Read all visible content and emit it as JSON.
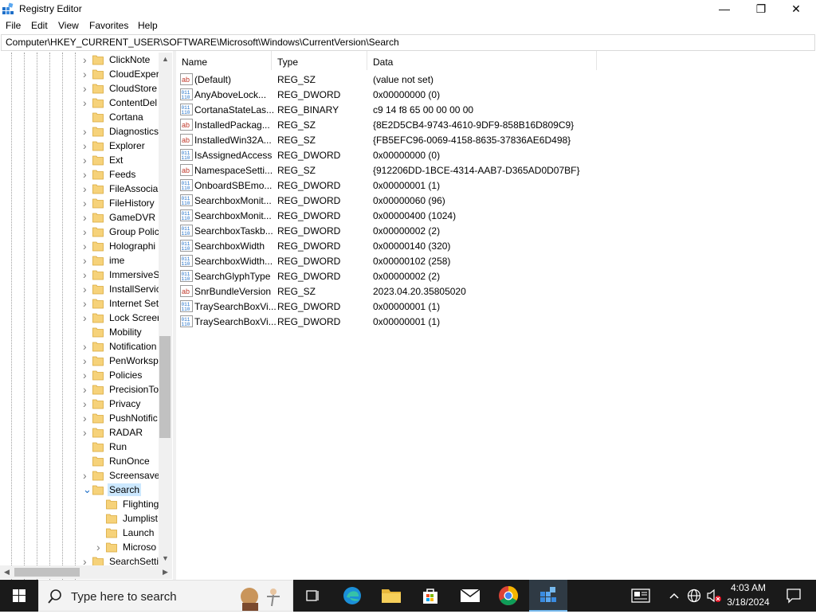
{
  "window": {
    "title": "Registry Editor",
    "minimize_glyph": "—",
    "maximize_glyph": "❐",
    "close_glyph": "✕"
  },
  "menu": [
    "File",
    "Edit",
    "View",
    "Favorites",
    "Help"
  ],
  "address": "Computer\\HKEY_CURRENT_USER\\SOFTWARE\\Microsoft\\Windows\\CurrentVersion\\Search",
  "tree": {
    "items": [
      {
        "label": "ClickNote",
        "expander": "collapsed"
      },
      {
        "label": "CloudExper",
        "expander": "collapsed"
      },
      {
        "label": "CloudStore",
        "expander": "collapsed"
      },
      {
        "label": "ContentDel",
        "expander": "collapsed"
      },
      {
        "label": "Cortana",
        "expander": "none"
      },
      {
        "label": "Diagnostics",
        "expander": "collapsed"
      },
      {
        "label": "Explorer",
        "expander": "collapsed"
      },
      {
        "label": "Ext",
        "expander": "collapsed"
      },
      {
        "label": "Feeds",
        "expander": "collapsed"
      },
      {
        "label": "FileAssocia",
        "expander": "collapsed"
      },
      {
        "label": "FileHistory",
        "expander": "collapsed"
      },
      {
        "label": "GameDVR",
        "expander": "collapsed"
      },
      {
        "label": "Group Polic",
        "expander": "collapsed"
      },
      {
        "label": "Holographi",
        "expander": "collapsed"
      },
      {
        "label": "ime",
        "expander": "collapsed"
      },
      {
        "label": "ImmersiveS",
        "expander": "collapsed"
      },
      {
        "label": "InstallServic",
        "expander": "collapsed"
      },
      {
        "label": "Internet Set",
        "expander": "collapsed"
      },
      {
        "label": "Lock Screer",
        "expander": "collapsed"
      },
      {
        "label": "Mobility",
        "expander": "none"
      },
      {
        "label": "Notification",
        "expander": "collapsed"
      },
      {
        "label": "PenWorksp",
        "expander": "collapsed"
      },
      {
        "label": "Policies",
        "expander": "collapsed"
      },
      {
        "label": "PrecisionTo",
        "expander": "collapsed"
      },
      {
        "label": "Privacy",
        "expander": "collapsed"
      },
      {
        "label": "PushNotific",
        "expander": "collapsed"
      },
      {
        "label": "RADAR",
        "expander": "collapsed"
      },
      {
        "label": "Run",
        "expander": "none"
      },
      {
        "label": "RunOnce",
        "expander": "none"
      },
      {
        "label": "Screensave",
        "expander": "collapsed"
      },
      {
        "label": "Search",
        "expander": "expanded",
        "selected": true
      },
      {
        "label": "Flighting",
        "expander": "none",
        "child": true
      },
      {
        "label": "Jumplist",
        "expander": "none",
        "child": true
      },
      {
        "label": "Launch",
        "expander": "none",
        "child": true
      },
      {
        "label": "Microso",
        "expander": "collapsed",
        "child": true
      },
      {
        "label": "SearchSetti",
        "expander": "collapsed"
      }
    ]
  },
  "list": {
    "columns": {
      "name": "Name",
      "type": "Type",
      "data": "Data"
    },
    "rows": [
      {
        "name": "(Default)",
        "type": "REG_SZ",
        "data": "(value not set)",
        "icon": "string-value-icon"
      },
      {
        "name": "AnyAboveLock...",
        "type": "REG_DWORD",
        "data": "0x00000000 (0)",
        "icon": "binary-value-icon"
      },
      {
        "name": "CortanaStateLas...",
        "type": "REG_BINARY",
        "data": "c9 14 f8 65 00 00 00 00",
        "icon": "binary-value-icon"
      },
      {
        "name": "InstalledPackag...",
        "type": "REG_SZ",
        "data": "{8E2D5CB4-9743-4610-9DF9-858B16D809C9}",
        "icon": "string-value-icon"
      },
      {
        "name": "InstalledWin32A...",
        "type": "REG_SZ",
        "data": "{FB5EFC96-0069-4158-8635-37836AE6D498}",
        "icon": "string-value-icon"
      },
      {
        "name": "IsAssignedAccess",
        "type": "REG_DWORD",
        "data": "0x00000000 (0)",
        "icon": "binary-value-icon"
      },
      {
        "name": "NamespaceSetti...",
        "type": "REG_SZ",
        "data": "{912206DD-1BCE-4314-AAB7-D365AD0D07BF}",
        "icon": "string-value-icon"
      },
      {
        "name": "OnboardSBEmo...",
        "type": "REG_DWORD",
        "data": "0x00000001 (1)",
        "icon": "binary-value-icon"
      },
      {
        "name": "SearchboxMonit...",
        "type": "REG_DWORD",
        "data": "0x00000060 (96)",
        "icon": "binary-value-icon"
      },
      {
        "name": "SearchboxMonit...",
        "type": "REG_DWORD",
        "data": "0x00000400 (1024)",
        "icon": "binary-value-icon"
      },
      {
        "name": "SearchboxTaskb...",
        "type": "REG_DWORD",
        "data": "0x00000002 (2)",
        "icon": "binary-value-icon"
      },
      {
        "name": "SearchboxWidth",
        "type": "REG_DWORD",
        "data": "0x00000140 (320)",
        "icon": "binary-value-icon"
      },
      {
        "name": "SearchboxWidth...",
        "type": "REG_DWORD",
        "data": "0x00000102 (258)",
        "icon": "binary-value-icon"
      },
      {
        "name": "SearchGlyphType",
        "type": "REG_DWORD",
        "data": "0x00000002 (2)",
        "icon": "binary-value-icon"
      },
      {
        "name": "SnrBundleVersion",
        "type": "REG_SZ",
        "data": "2023.04.20.35805020",
        "icon": "string-value-icon"
      },
      {
        "name": "TraySearchBoxVi...",
        "type": "REG_DWORD",
        "data": "0x00000001 (1)",
        "icon": "binary-value-icon"
      },
      {
        "name": "TraySearchBoxVi...",
        "type": "REG_DWORD",
        "data": "0x00000001 (1)",
        "icon": "binary-value-icon"
      }
    ]
  },
  "taskbar": {
    "search_placeholder": "Type here to search",
    "time": "4:03 AM",
    "date": "3/18/2024",
    "colors": {
      "background": "#1a1a1a",
      "accent": "#76b9ed"
    }
  }
}
